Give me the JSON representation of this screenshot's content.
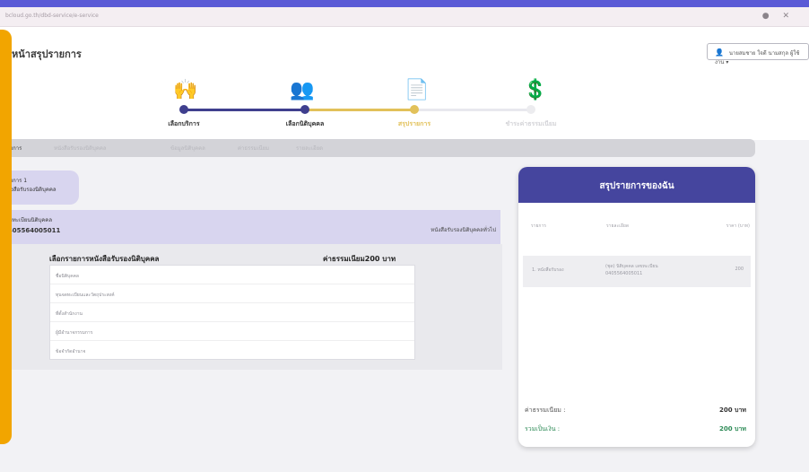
{
  "browser": {
    "url": "bcloud.go.th/dbd-service/e-service",
    "controls": "● ✕"
  },
  "header": {
    "page_title": "หน้าสรุปรายการ",
    "user_label": "นายสมชาย ใจดี นามสกุล ผู้ใช้งาน"
  },
  "stepper": {
    "steps": [
      {
        "label": "เลือกบริการ",
        "icon": "hand-service-icon",
        "state": "done"
      },
      {
        "label": "เลือกนิติบุคคล",
        "icon": "group-icon",
        "state": "done"
      },
      {
        "label": "สรุปรายการ",
        "icon": "document-icon",
        "state": "active"
      },
      {
        "label": "ชำระค่าธรรมเนียม",
        "icon": "payment-icon",
        "state": "pending"
      }
    ]
  },
  "tabs": [
    "รายการ",
    "หนังสือรับรองนิติบุคคล",
    "ข้อมูลนิติบุคคล",
    "ค่าธรรมเนียม",
    "รายละเอียด"
  ],
  "company": {
    "chip_line1": "รายการ 1",
    "chip_line2": "หนังสือรับรองนิติบุคคล",
    "id_label": "เลขทะเบียนนิติบุคคล",
    "id_number": "0405564005011",
    "doc_type": "หนังสือรับรองนิติบุคคลทั่วไป"
  },
  "detail": {
    "title": "เลือกรายการหนังสือรับรองนิติบุคคล",
    "fee": "ค่าธรรมเนียม200 บาท",
    "rows": [
      "ชื่อนิติบุคคล",
      "ทุนจดทะเบียนและวัตถุประสงค์",
      "ที่ตั้งสำนักงาน",
      "ผู้มีอำนาจกรรมการ",
      "ข้อจำกัดอำนาจ"
    ]
  },
  "cart": {
    "title": "สรุปรายการของฉัน",
    "col_item": "รายการ",
    "col_desc": "รายละเอียด",
    "col_price": "ราคา (บาท)",
    "item_name": "1. หนังสือรับรอง",
    "item_desc": "(ชุด) นิติบุคคล เลขทะเบียน 0405564005011",
    "item_price": "200",
    "fee_label": "ค่าธรรมเนียม :",
    "fee_value": "200 บาท",
    "total_label": "รวมเป็นเงิน :",
    "total_value": "200 บาท"
  },
  "colors": {
    "primary": "#45459e",
    "accent": "#f2a500",
    "active_step": "#e2c15a",
    "total_text": "#2e8b57"
  }
}
